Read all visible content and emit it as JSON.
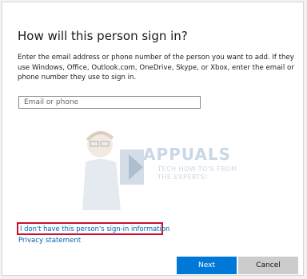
{
  "dialog": {
    "title": "How will this person sign in?",
    "description": "Enter the email address or phone number of the person you want to add. If they use Windows, Office, Outlook.com, OneDrive, Skype, or Xbox, enter the email or phone number they use to sign in.",
    "email_input": {
      "placeholder": "Email or phone",
      "value": ""
    },
    "no_info_link": "I don't have this person's sign-in information",
    "privacy_link": "Privacy statement",
    "next_button": "Next",
    "cancel_button": "Cancel"
  },
  "watermark": {
    "brand": "APPUALS",
    "tagline": "TECH HOW-TO'S FROM THE EXPERTS!"
  },
  "colors": {
    "accent": "#0078d7",
    "link": "#0063b1",
    "highlight_border": "#c8102e",
    "cancel_bg": "#cccccc"
  }
}
